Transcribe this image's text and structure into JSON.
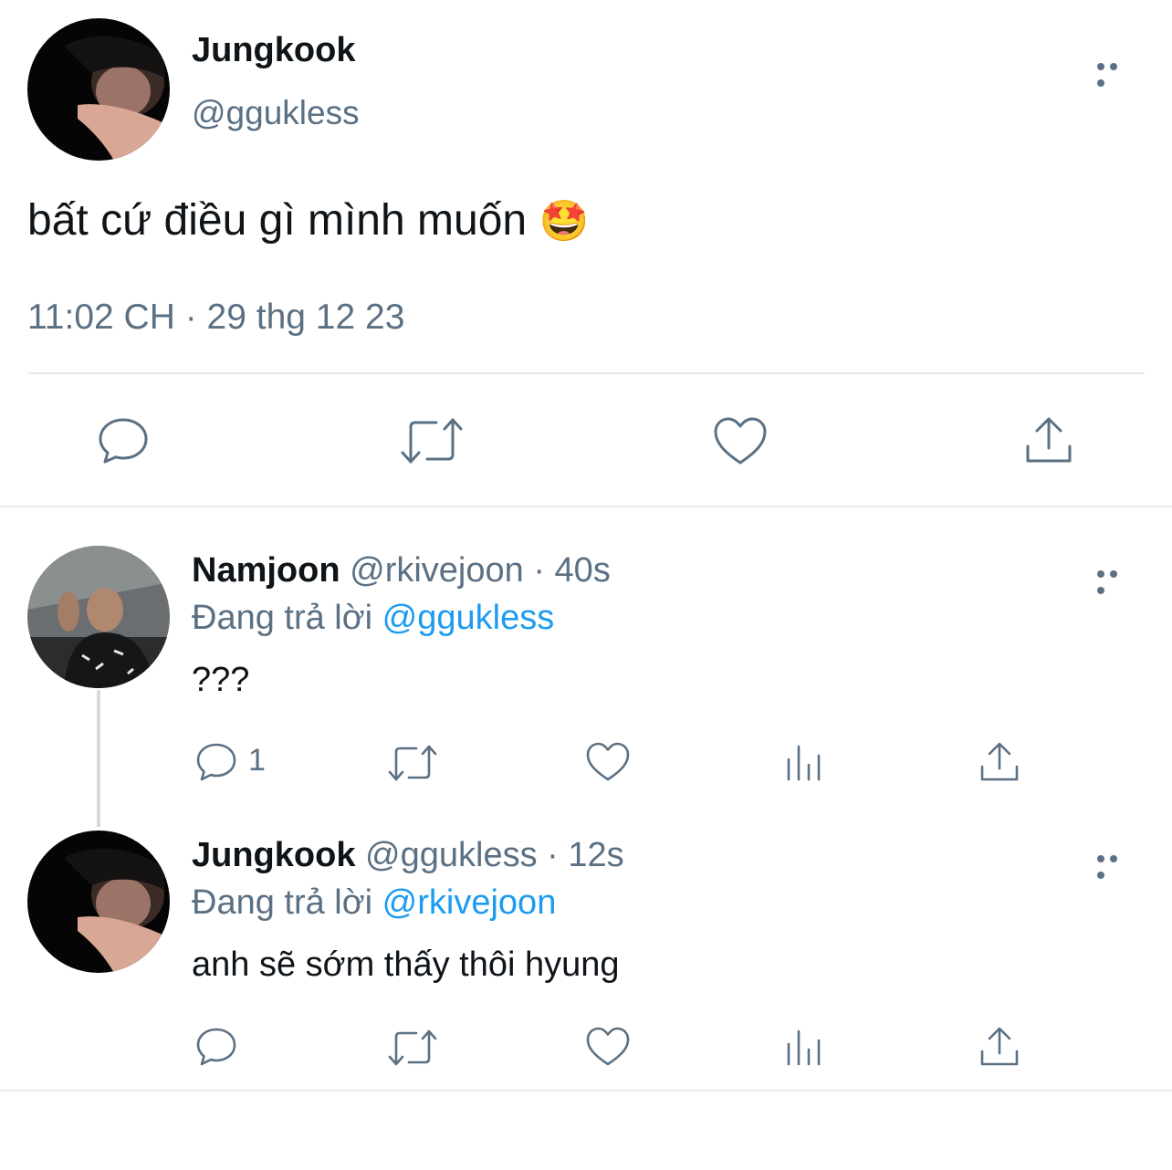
{
  "main_tweet": {
    "author_name": "Jungkook",
    "handle": "@ggukless",
    "text": "bất cứ điều gì mình muốn",
    "emoji": "🤩",
    "timestamp": "11:02 CH · 29 thg 12 23"
  },
  "replies": [
    {
      "author_name": "Namjoon",
      "handle": "@rkivejoon",
      "time": " · 40s",
      "replying_prefix": "Đang trả lời ",
      "replying_to": "@ggukless",
      "text": "???",
      "reply_count": "1"
    },
    {
      "author_name": "Jungkook",
      "handle": "@ggukless",
      "time": " · 12s",
      "replying_prefix": "Đang trả lời ",
      "replying_to": "@rkivejoon",
      "text": "anh sẽ sớm thấy thôi hyung",
      "reply_count": ""
    }
  ],
  "icons": [
    "more-icon",
    "reply-icon",
    "retweet-icon",
    "like-icon",
    "share-icon",
    "analytics-icon"
  ],
  "colors": {
    "text": "#0f1419",
    "muted": "#5b7083",
    "link": "#1d9bf0",
    "divider": "#e7ebee"
  }
}
